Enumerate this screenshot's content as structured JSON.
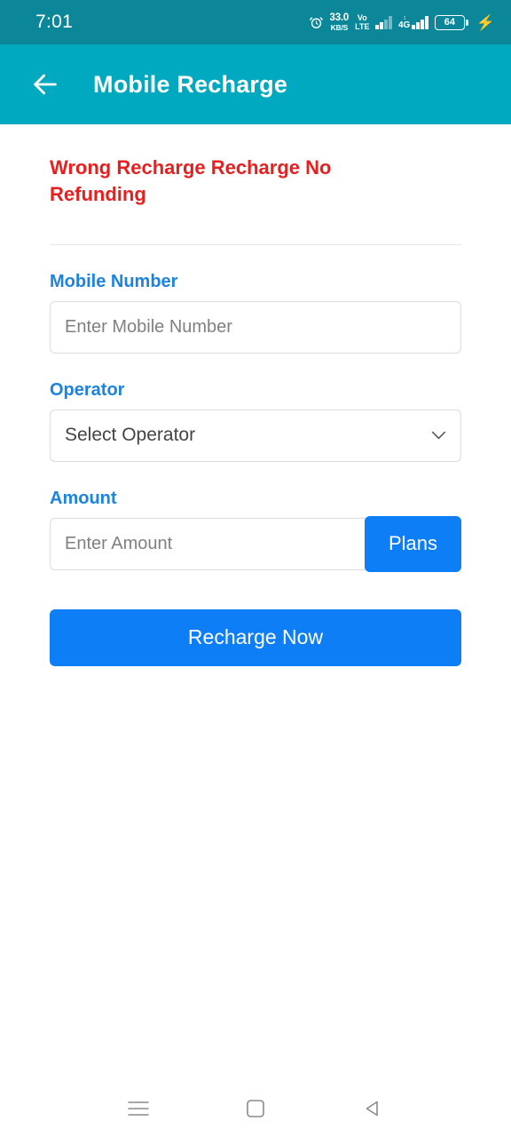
{
  "status_bar": {
    "time": "7:01",
    "alarm_icon": "alarm-clock-icon",
    "network_speed_value": "33.0",
    "network_speed_unit": "KB/S",
    "volte_line1": "Vo",
    "volte_line2": "LTE",
    "data_type": "4G",
    "data_arrows": "↕",
    "battery_level": "64",
    "charging_icon": "⚡",
    "background_color": "#0c8799"
  },
  "app_bar": {
    "back_icon": "back-arrow-icon",
    "title": "Mobile Recharge",
    "background_color": "#00a9c0"
  },
  "content": {
    "warning_text": "Wrong Recharge Recharge No Refunding",
    "warning_color": "#e81f1f",
    "label_color": "#1b84e0",
    "mobile_number": {
      "label": "Mobile Number",
      "value": "",
      "placeholder": "Enter Mobile Number"
    },
    "operator": {
      "label": "Operator",
      "selected": "Select Operator",
      "chevron_icon": "chevron-down-icon"
    },
    "amount": {
      "label": "Amount",
      "value": "",
      "placeholder": "Enter Amount",
      "plans_button": "Plans"
    },
    "primary_button": "Recharge Now",
    "primary_button_color": "#0d7ef5"
  },
  "nav_bar": {
    "recents_icon": "menu-icon",
    "home_icon": "home-square-icon",
    "back_icon": "back-triangle-icon"
  }
}
